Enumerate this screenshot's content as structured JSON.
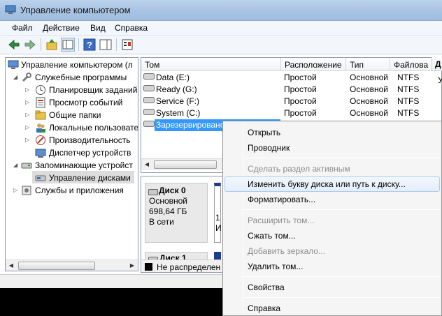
{
  "window": {
    "title": "Управление компьютером"
  },
  "menu": [
    {
      "label": "Файл"
    },
    {
      "label": "Действие"
    },
    {
      "label": "Вид"
    },
    {
      "label": "Справка"
    }
  ],
  "tree": {
    "root": "Управление компьютером (л",
    "system_tools": "Служебные программы",
    "task_scheduler": "Планировщик заданий",
    "event_viewer": "Просмотр событий",
    "shared_folders": "Общие папки",
    "local_users": "Локальные пользовате",
    "performance": "Производительность",
    "device_manager": "Диспетчер устройств",
    "storage": "Запоминающие устройст",
    "disk_management": "Управление дисками",
    "services": "Службы и приложения"
  },
  "volumes": {
    "columns": [
      {
        "label": "Том"
      },
      {
        "label": "Расположение"
      },
      {
        "label": "Тип"
      },
      {
        "label": "Файлова"
      }
    ],
    "rows": [
      {
        "name": "Data (E:)",
        "layout": "Простой",
        "type": "Основной",
        "fs": "NTFS"
      },
      {
        "name": "Ready (G:)",
        "layout": "Простой",
        "type": "Основной",
        "fs": "NTFS"
      },
      {
        "name": "Service (F:)",
        "layout": "Простой",
        "type": "Основной",
        "fs": "NTFS"
      },
      {
        "name": "System (C:)",
        "layout": "Простой",
        "type": "Основной",
        "fs": "NTFS"
      },
      {
        "name": "Зарезервировано",
        "layout": "",
        "type": "",
        "fs": ""
      }
    ]
  },
  "disk0": {
    "name": "Диск 0",
    "type": "Основной",
    "size": "698,64 ГБ",
    "status": "В сети",
    "part_text_1": "1",
    "part_text_2": "И"
  },
  "disk1": {
    "name": "Диск 1"
  },
  "legend": {
    "unallocated": "Не распределен"
  },
  "actions": {
    "header": "Д",
    "item": "У"
  },
  "context_menu": {
    "open": "Открыть",
    "explorer": "Проводник",
    "mark_active": "Сделать раздел активным",
    "change_letter": "Изменить букву диска или путь к диску...",
    "format": "Форматировать...",
    "extend": "Расширить том...",
    "shrink": "Сжать том...",
    "add_mirror": "Добавить зеркало...",
    "delete": "Удалить том...",
    "properties": "Свойства",
    "help": "Справка"
  },
  "colors": {
    "selection": "#3399ff",
    "primary_partition": "#1e3b8f",
    "unallocated": "#000000"
  }
}
